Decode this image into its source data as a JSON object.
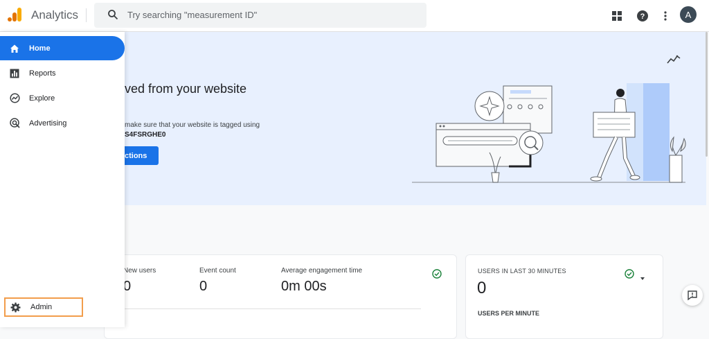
{
  "app": {
    "title": "Analytics"
  },
  "search": {
    "placeholder": "Try searching \"measurement ID\""
  },
  "account": {
    "avatar_letter": "A"
  },
  "sidebar": {
    "items": [
      {
        "label": "Home",
        "icon": "home-icon",
        "active": true
      },
      {
        "label": "Reports",
        "icon": "reports-icon",
        "active": false
      },
      {
        "label": "Explore",
        "icon": "explore-icon",
        "active": false
      },
      {
        "label": "Advertising",
        "icon": "advertising-icon",
        "active": false
      }
    ],
    "admin_label": "Admin"
  },
  "hero": {
    "title_visible": "ved from your website",
    "desc_visible": "make sure that your website is tagged using",
    "id_visible": "S4FSRGHE0",
    "button_visible": "ctions"
  },
  "metrics": [
    {
      "label": "New users",
      "label_visible": "New users",
      "value": "0"
    },
    {
      "label": "Event count",
      "value": "0"
    },
    {
      "label": "Average engagement time",
      "value": "0m 00s"
    }
  ],
  "realtime": {
    "title": "USERS IN LAST 30 MINUTES",
    "value": "0",
    "subtitle": "USERS PER MINUTE"
  },
  "colors": {
    "accent": "#1a73e8",
    "hero_bg": "#e8f0fe",
    "admin_highlight": "#f29d4b",
    "success": "#188038"
  }
}
